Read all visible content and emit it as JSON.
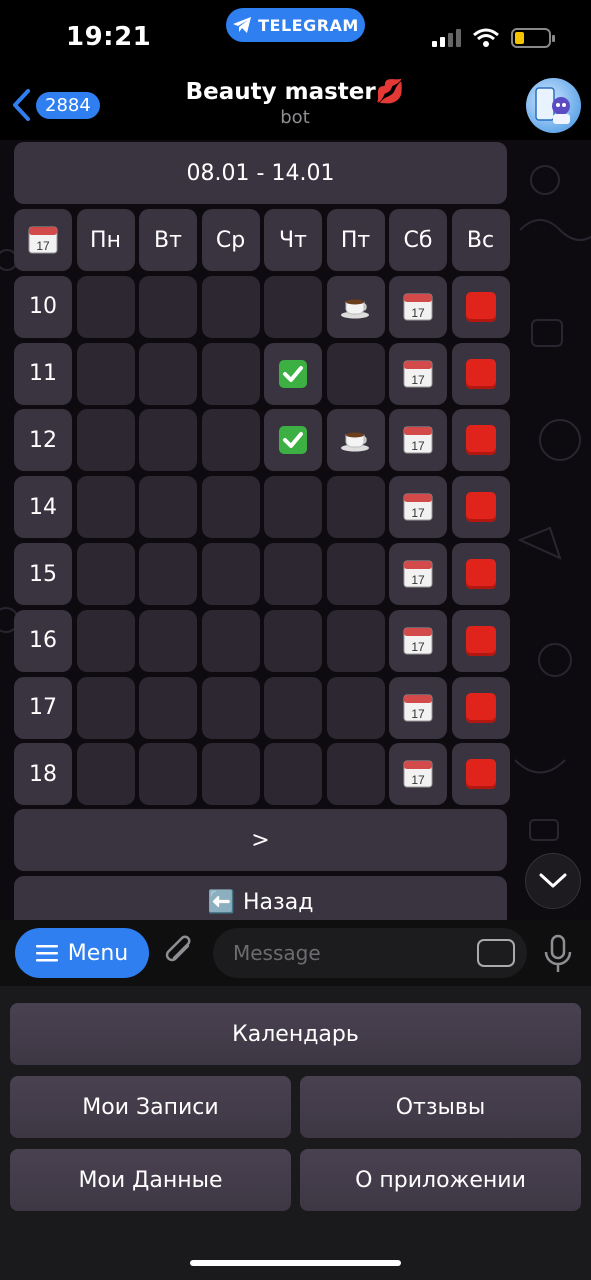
{
  "status_bar": {
    "time": "19:21",
    "telegram_label": "TELEGRAM"
  },
  "header": {
    "back_count": "2884",
    "title": "Beauty master",
    "title_emoji": "💋",
    "subtitle": "bot"
  },
  "calendar": {
    "week_range": "08.01 - 14.01",
    "days": [
      "Пн",
      "Вт",
      "Ср",
      "Чт",
      "Пт",
      "Сб",
      "Вс"
    ],
    "rows": [
      {
        "hour": "10",
        "cells": [
          "",
          "",
          "",
          "",
          "coffee",
          "calendar",
          "red"
        ]
      },
      {
        "hour": "11",
        "cells": [
          "",
          "",
          "",
          "check",
          "",
          "calendar",
          "red"
        ]
      },
      {
        "hour": "12",
        "cells": [
          "",
          "",
          "",
          "check",
          "coffee",
          "calendar",
          "red"
        ]
      },
      {
        "hour": "14",
        "cells": [
          "",
          "",
          "",
          "",
          "",
          "calendar",
          "red"
        ]
      },
      {
        "hour": "15",
        "cells": [
          "",
          "",
          "",
          "",
          "",
          "calendar",
          "red"
        ]
      },
      {
        "hour": "16",
        "cells": [
          "",
          "",
          "",
          "",
          "",
          "calendar",
          "red"
        ]
      },
      {
        "hour": "17",
        "cells": [
          "",
          "",
          "",
          "",
          "",
          "calendar",
          "red"
        ]
      },
      {
        "hour": "18",
        "cells": [
          "",
          "",
          "",
          "",
          "",
          "calendar",
          "red"
        ]
      }
    ],
    "next_label": ">",
    "back_label": "Назад",
    "back_icon": "⬅️"
  },
  "input": {
    "menu_label": "Menu",
    "placeholder": "Message"
  },
  "reply_keyboard": {
    "calendar": "Календарь",
    "my_bookings": "Мои Записи",
    "reviews": "Отзывы",
    "my_data": "Мои Данные",
    "about": "О приложении"
  }
}
